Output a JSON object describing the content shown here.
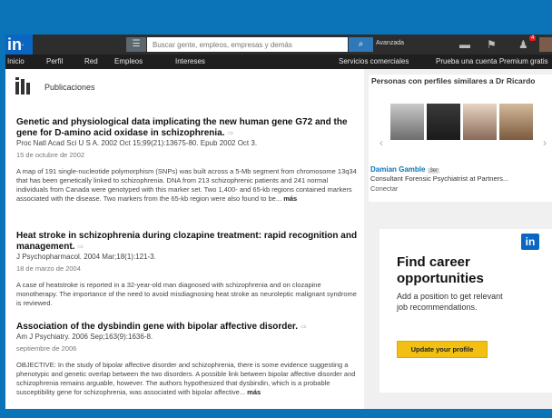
{
  "topbar": {
    "logo": "in",
    "search_placeholder": "Buscar gente, empleos, empresas y demás",
    "advanced": "Avanzada",
    "notification_count": "4"
  },
  "nav": {
    "items": [
      "Inicio",
      "Perfil",
      "Red",
      "Empleos",
      "Intereses"
    ],
    "right_items": [
      "Servicios comerciales",
      "Prueba una cuenta Premium gratis"
    ]
  },
  "section": {
    "title": "Publicaciones"
  },
  "publications": [
    {
      "title": "Genetic and physiological data implicating the new human gene G72 and the gene for D-amino acid oxidase in schizophrenia.",
      "source": "Proc Natl Acad Sci U S A. 2002 Oct 15;99(21):13675-80. Epub 2002 Oct 3.",
      "date": "15 de octubre de 2002",
      "abstract": "A map of 191 single-nucleotide polymorphism (SNPs) was built across a 5-Mb segment from chromosome 13q34 that has been genetically linked to schizophrenia. DNA from 213 schizophrenic patients and 241 normal individuals from Canada were genotyped with this marker set. Two 1,400- and 65-kb regions contained markers associated with the disease. Two markers from the 65-kb region were also found to be...",
      "more": "más"
    },
    {
      "title": "Heat stroke in schizophrenia during clozapine treatment: rapid recognition and management.",
      "source": "J Psychopharmacol. 2004 Mar;18(1):121-3.",
      "date": "18 de marzo de 2004",
      "abstract": "A case of heatstroke is reported in a 32-year-old man diagnosed with schizophrenia and on clozapine monotherapy. The importance of the need to avoid misdiagnosing heat stroke as neuroleptic malignant syndrome is reviewed.",
      "more": ""
    },
    {
      "title": "Association of the dysbindin gene with bipolar affective disorder.",
      "source": "Am J Psychiatry. 2006 Sep;163(9):1636-8.",
      "date": "septiembre de 2006",
      "abstract": "OBJECTIVE: In the study of bipolar affective disorder and schizophrenia, there is some evidence suggesting a phenotypic and genetic overlap between the two disorders. A possible link between bipolar affective disorder and schizophrenia remains arguable, however. The authors hypothesized that dysbindin, which is a probable susceptibility gene for schizophrenia, was associated with bipolar affective...",
      "more": "más"
    }
  ],
  "similar": {
    "title": "Personas con perfiles similares a Dr Ricardo",
    "person_name": "Damian Gamble",
    "degree": "3er",
    "role": "Consultant Forensic Psychiatrist at Partners...",
    "connect": "Conectar"
  },
  "ad": {
    "logo": "in",
    "headline": "Find career opportunities",
    "text": "Add a position to get relevant job recommendations.",
    "button": "Update your profile"
  },
  "colors": {
    "frame": "#0b74b8",
    "brand": "#0a66c2",
    "cta": "#f2c012"
  }
}
